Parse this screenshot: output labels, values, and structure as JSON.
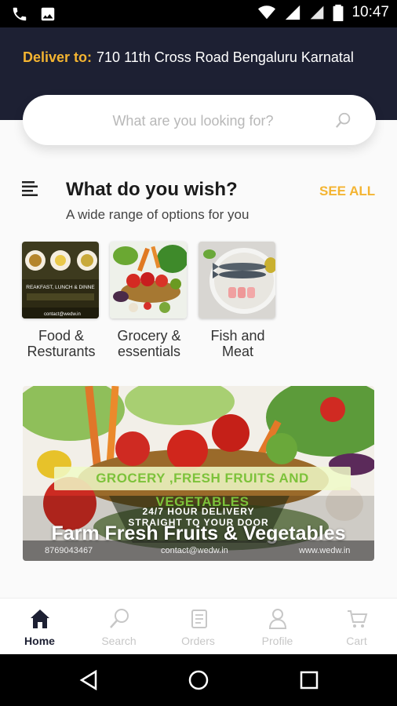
{
  "status_bar": {
    "time": "10:47"
  },
  "header": {
    "deliver_label": "Deliver to:",
    "address": "710 11th Cross Road Bengaluru Karnatal"
  },
  "search": {
    "placeholder": "What are you looking for?"
  },
  "section": {
    "title": "What do you wish?",
    "subtitle": "A wide range of options for you",
    "see_all": "SEE ALL"
  },
  "categories": [
    {
      "label": "Food &\nResturants",
      "thumb_text_1": "REAKFAST, LUNCH & DINNE",
      "thumb_text_2": "contact@wedw.in"
    },
    {
      "label": "Grocery &\nessentials"
    },
    {
      "label": "Fish and\nMeat"
    }
  ],
  "banner": {
    "headline": "GROCERY ,FRESH FRUITS AND VEGETABLES",
    "line1": "24/7 HOUR DELIVERY",
    "line2": "STRAIGHT TO YOUR DOOR",
    "big_text": "Farm Fresh Fruits & Vegetables",
    "phone": "8769043467",
    "email": "contact@wedw.in",
    "web": "www.wedw.in"
  },
  "bottom_nav": [
    {
      "label": "Home",
      "icon": "home-icon",
      "active": true
    },
    {
      "label": "Search",
      "icon": "search-icon",
      "active": false
    },
    {
      "label": "Orders",
      "icon": "orders-icon",
      "active": false
    },
    {
      "label": "Profile",
      "icon": "profile-icon",
      "active": false
    },
    {
      "label": "Cart",
      "icon": "cart-icon",
      "active": false
    }
  ],
  "colors": {
    "header_bg": "#1d2033",
    "accent": "#f4b431",
    "nav_inactive": "#c7c7c7"
  }
}
